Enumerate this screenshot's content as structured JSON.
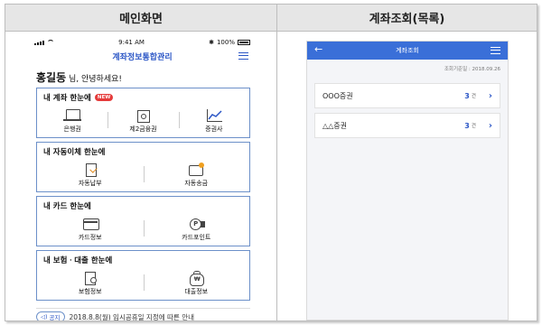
{
  "left": {
    "header": "메인화면",
    "status": {
      "time": "9:41 AM",
      "battery": "100%"
    },
    "app_title": "계좌정보통합관리",
    "greeting": {
      "name": "홍길동",
      "suffix": "님, 안녕하세요!"
    },
    "sections": [
      {
        "title": "내 계좌 한눈에",
        "badge": "NEW",
        "items": [
          {
            "label": "은행권",
            "icon": "laptop-icon"
          },
          {
            "label": "제2금융권",
            "icon": "safe-icon"
          },
          {
            "label": "증권사",
            "icon": "chart-icon"
          }
        ]
      },
      {
        "title": "내 자동이체 한눈에",
        "items": [
          {
            "label": "자동납부",
            "icon": "checklist-icon"
          },
          {
            "label": "자동송금",
            "icon": "wallet-icon"
          }
        ]
      },
      {
        "title": "내 카드 한눈에",
        "items": [
          {
            "label": "카드정보",
            "icon": "card-icon"
          },
          {
            "label": "카드포인트",
            "icon": "point-icon"
          }
        ]
      },
      {
        "title": "내 보험ㆍ대출 한눈에",
        "items": [
          {
            "label": "보험정보",
            "icon": "search-doc-icon"
          },
          {
            "label": "대출정보",
            "icon": "money-bag-icon"
          }
        ]
      }
    ],
    "notice": {
      "badge": "공지",
      "text": "2018.8.8(월) 임시공휴일 지정에 따른 안내"
    }
  },
  "right": {
    "header": "계좌조회(목록)",
    "topbar_title": "계좌조회",
    "query_date": "조회기준일 : 2018.09.26",
    "accounts": [
      {
        "name": "OOO증권",
        "count": "3",
        "unit": "건"
      },
      {
        "name": "△△증권",
        "count": "3",
        "unit": "건"
      }
    ]
  },
  "colors": {
    "accent": "#3a6fd8",
    "card_border": "#6c90c9",
    "badge_red": "#e53b3b"
  }
}
